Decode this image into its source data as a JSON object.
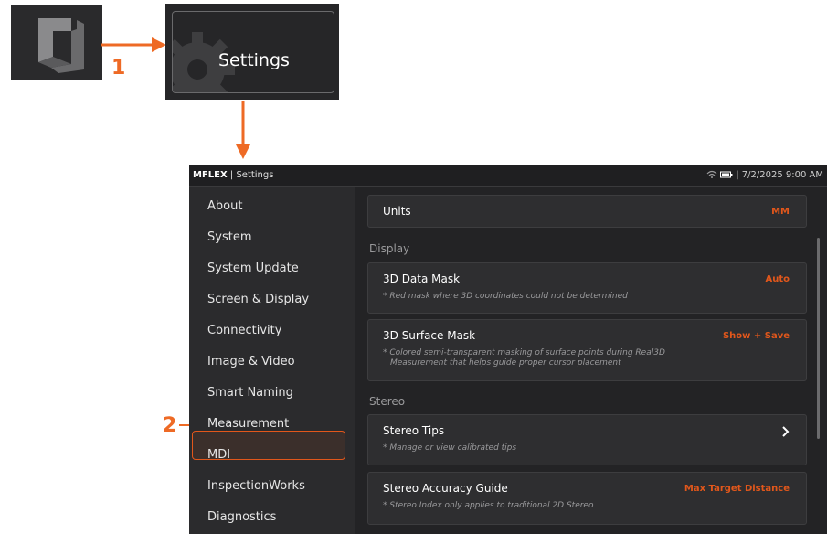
{
  "callouts": {
    "step1": "1",
    "step2": "2"
  },
  "settings_tile": {
    "label": "Settings"
  },
  "topbar": {
    "brand": "MFLEX",
    "separator": " | ",
    "title": "Settings",
    "datetime": "7/2/2025 9:00 AM"
  },
  "sidebar": {
    "items": [
      {
        "label": "About"
      },
      {
        "label": "System"
      },
      {
        "label": "System Update"
      },
      {
        "label": "Screen & Display"
      },
      {
        "label": "Connectivity"
      },
      {
        "label": "Image & Video"
      },
      {
        "label": "Smart Naming"
      },
      {
        "label": "Measurement"
      },
      {
        "label": "MDI"
      },
      {
        "label": "InspectionWorks"
      },
      {
        "label": "Diagnostics"
      }
    ],
    "selected": "Measurement"
  },
  "content": {
    "units": {
      "title": "Units",
      "value": "MM"
    },
    "section_display": "Display",
    "data_mask": {
      "title": "3D Data Mask",
      "value": "Auto",
      "desc": "* Red mask where 3D coordinates could not be determined"
    },
    "surface_mask": {
      "title": "3D Surface Mask",
      "value": "Show + Save",
      "desc1": "* Colored semi-transparent masking of surface points during Real3D",
      "desc2": "Measurement that helps guide proper cursor placement"
    },
    "section_stereo": "Stereo",
    "stereo_tips": {
      "title": "Stereo Tips",
      "desc": "* Manage or view calibrated tips"
    },
    "accuracy_guide": {
      "title": "Stereo Accuracy Guide",
      "value": "Max Target Distance",
      "desc": "* Stereo Index only applies to traditional 2D Stereo"
    }
  },
  "colors": {
    "accent": "#e2571b",
    "arrow": "#ee6a25",
    "panel": "#2b2b2d"
  },
  "icons": {
    "app_logo": "waygate-logo-icon",
    "settings": "gear-icon",
    "chevron": "chevron-right-icon",
    "wifi": "wifi-icon",
    "battery": "battery-icon"
  }
}
